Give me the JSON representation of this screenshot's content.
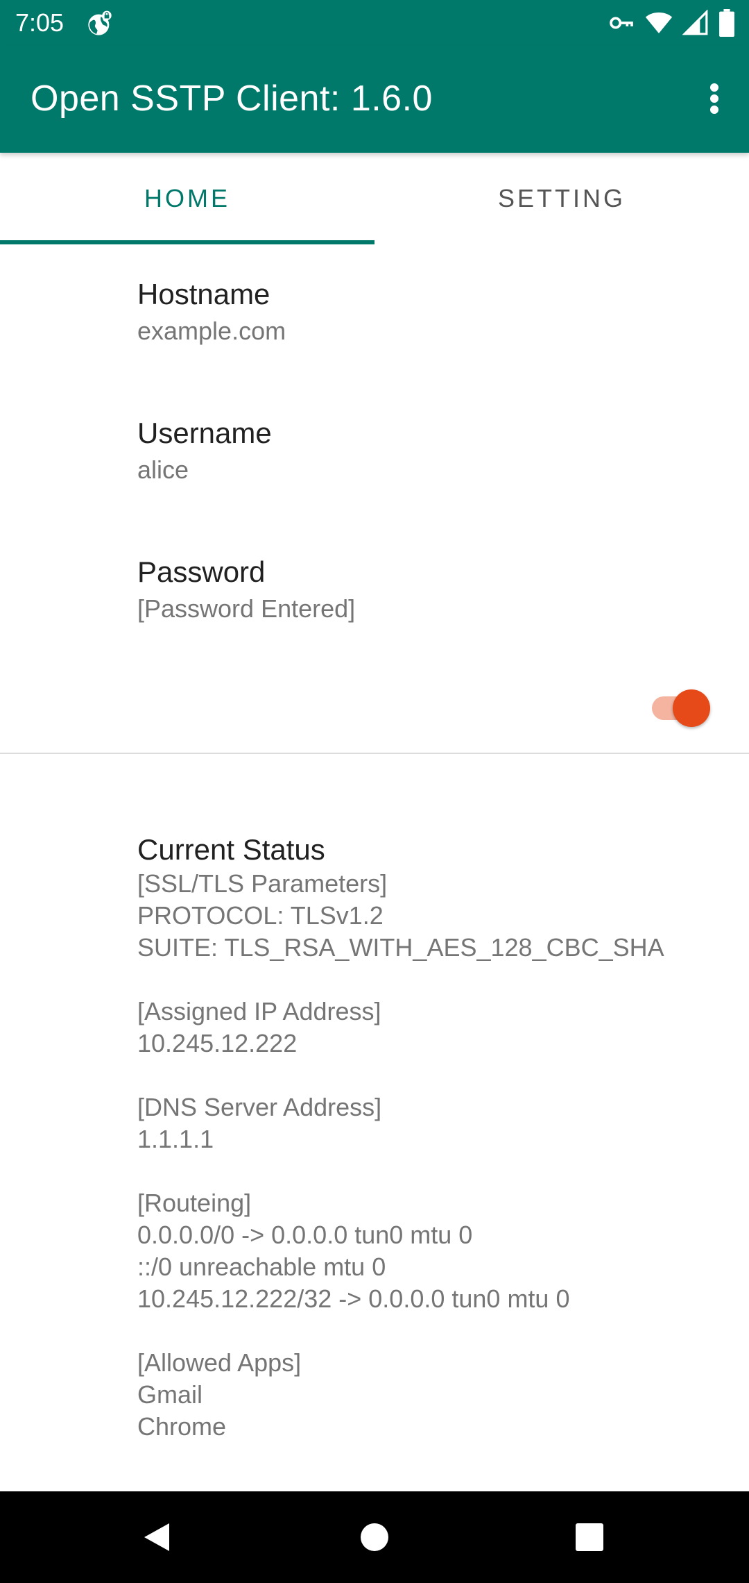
{
  "status_bar": {
    "time": "7:05"
  },
  "app_bar": {
    "title": "Open SSTP Client: 1.6.0"
  },
  "tabs": [
    {
      "label": "HOME",
      "active": true
    },
    {
      "label": "SETTING",
      "active": false
    }
  ],
  "preferences": {
    "hostname": {
      "title": "Hostname",
      "summary": "example.com"
    },
    "username": {
      "title": "Username",
      "summary": "alice"
    },
    "password": {
      "title": "Password",
      "summary": "[Password Entered]"
    },
    "connect_switch": {
      "on": true
    }
  },
  "current_status": {
    "title": "Current Status",
    "blocks": [
      [
        "[SSL/TLS Parameters]",
        "PROTOCOL: TLSv1.2",
        "SUITE: TLS_RSA_WITH_AES_128_CBC_SHA"
      ],
      [
        "[Assigned IP Address]",
        "10.245.12.222"
      ],
      [
        "[DNS Server Address]",
        "1.1.1.1"
      ],
      [
        "[Routeing]",
        "0.0.0.0/0 -> 0.0.0.0 tun0 mtu 0",
        "::/0 unreachable mtu 0",
        "10.245.12.222/32 -> 0.0.0.0 tun0 mtu 0"
      ],
      [
        "[Allowed Apps]",
        "Gmail",
        "Chrome"
      ]
    ]
  },
  "colors": {
    "primary": "#00796b",
    "accent": "#e64a19"
  },
  "icons": {
    "status_left": "vpn-globe-icon",
    "status_right": [
      "vpn-key-icon",
      "wifi-icon",
      "cell-signal-icon",
      "battery-icon"
    ],
    "app_bar": "more-vert-icon",
    "nav": [
      "back-icon",
      "home-icon",
      "recents-icon"
    ]
  }
}
